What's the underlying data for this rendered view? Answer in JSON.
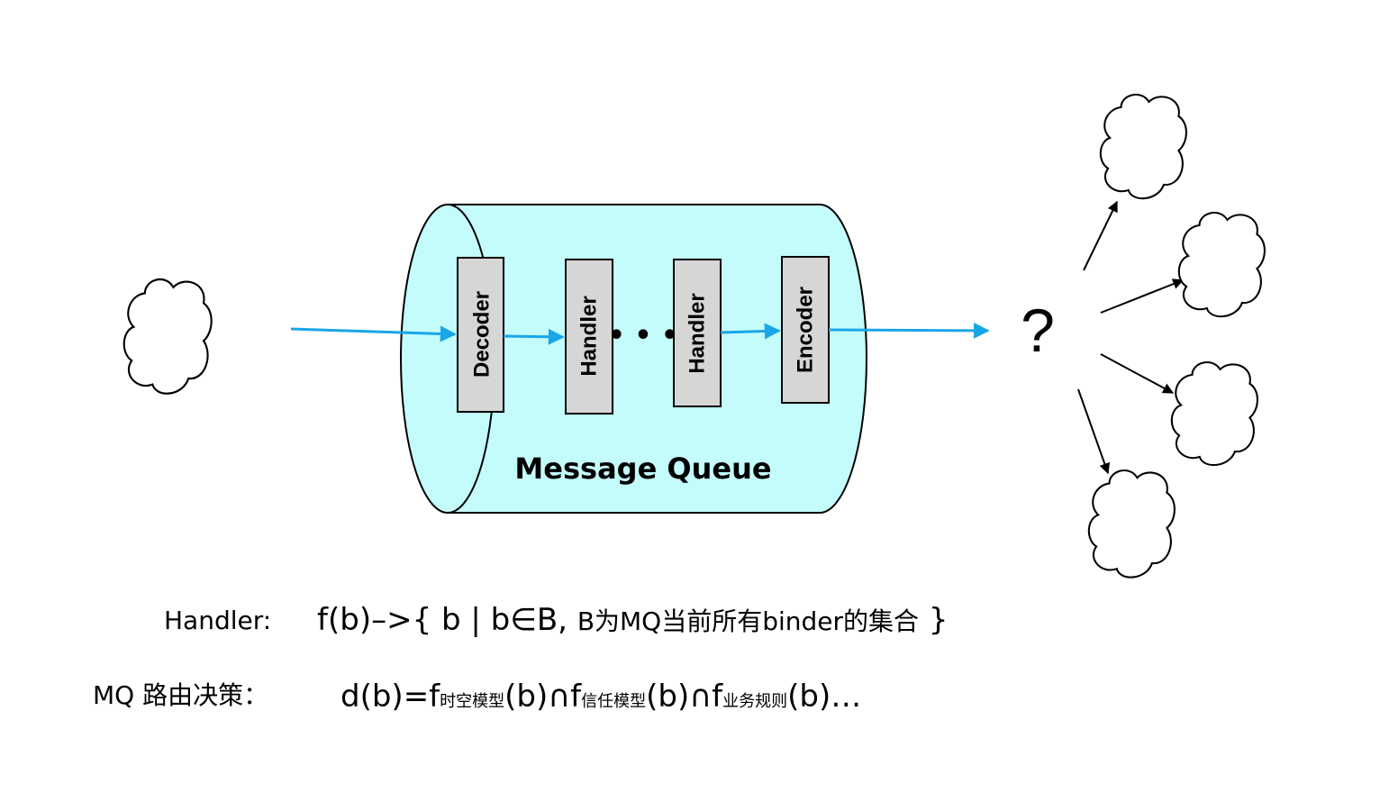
{
  "diagram": {
    "mq_title": "Message Queue",
    "stages": [
      {
        "label": "Decoder"
      },
      {
        "label": "Handler"
      },
      {
        "label": "Handler"
      },
      {
        "label": "Encoder"
      }
    ],
    "ellipsis": "• • •",
    "question": "?",
    "colors": {
      "cylinder_fill": "#c4fbfb",
      "arrow_blue": "#1aa6e6",
      "box_fill": "#d6d6d6",
      "stroke": "#000000"
    }
  },
  "formulas": {
    "handler": {
      "label": "Handler:",
      "expr_prefix": "f(b)–>{ b | b∈B, ",
      "expr_cn": "B为MQ当前所有binder的集合",
      "expr_suffix": " }"
    },
    "routing": {
      "label": "MQ 路由决策：",
      "p1": "d(b)=f",
      "s1": "时空模型",
      "p2": "(b)∩f",
      "s2": "信任模型",
      "p3": "(b)∩f",
      "s3": "业务规则",
      "p4": "(b)…"
    }
  }
}
